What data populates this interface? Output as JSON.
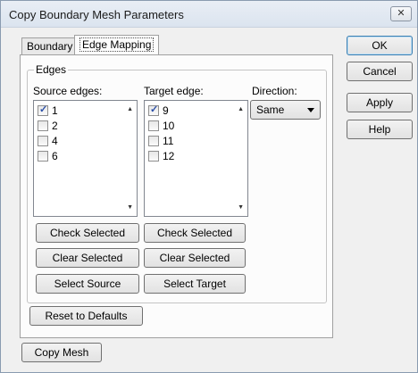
{
  "window": {
    "title": "Copy Boundary Mesh Parameters",
    "close_glyph": "✕"
  },
  "tabs": [
    {
      "label": "Boundary"
    },
    {
      "label": "Edge Mapping"
    }
  ],
  "edges_group": {
    "title": "Edges",
    "source": {
      "label": "Source edges:",
      "items": [
        {
          "label": "1",
          "checked": true
        },
        {
          "label": "2",
          "checked": false
        },
        {
          "label": "4",
          "checked": false
        },
        {
          "label": "6",
          "checked": false
        }
      ],
      "check_selected": "Check Selected",
      "clear_selected": "Clear Selected",
      "select": "Select Source"
    },
    "target": {
      "label": "Target edge:",
      "items": [
        {
          "label": "9",
          "checked": true
        },
        {
          "label": "10",
          "checked": false
        },
        {
          "label": "11",
          "checked": false
        },
        {
          "label": "12",
          "checked": false
        }
      ],
      "check_selected": "Check Selected",
      "clear_selected": "Clear Selected",
      "select": "Select Target"
    },
    "direction": {
      "label": "Direction:",
      "value": "Same"
    }
  },
  "reset_label": "Reset to Defaults",
  "copy_mesh_label": "Copy Mesh",
  "side_buttons": {
    "ok": "OK",
    "cancel": "Cancel",
    "apply": "Apply",
    "help": "Help"
  },
  "glyphs": {
    "scroll_up": "▲",
    "scroll_down": "▼"
  }
}
